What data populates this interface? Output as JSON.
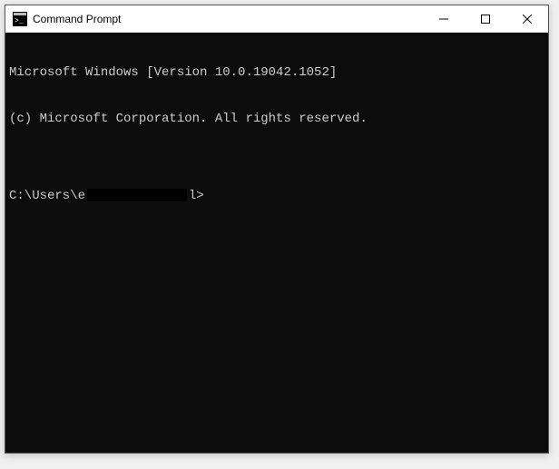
{
  "window": {
    "title": "Command Prompt"
  },
  "terminal": {
    "line1": "Microsoft Windows [Version 10.0.19042.1052]",
    "line2": "(c) Microsoft Corporation. All rights reserved.",
    "blank": "",
    "prompt_prefix": "C:\\Users\\e",
    "prompt_suffix": "l>"
  }
}
